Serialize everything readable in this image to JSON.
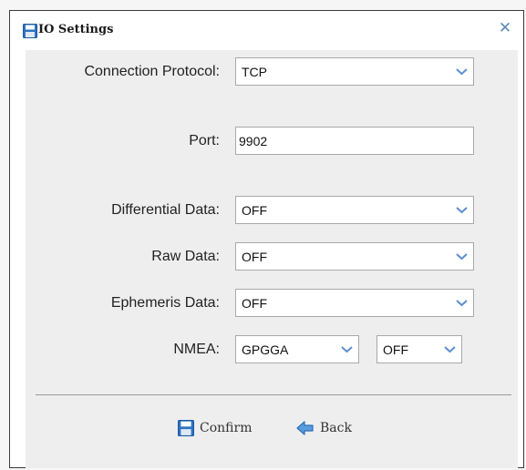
{
  "window": {
    "title": "IO Settings"
  },
  "form": {
    "connection_protocol": {
      "label": "Connection Protocol:",
      "value": "TCP"
    },
    "port": {
      "label": "Port:",
      "value": "9902"
    },
    "differential_data": {
      "label": "Differential Data:",
      "value": "OFF"
    },
    "raw_data": {
      "label": "Raw Data:",
      "value": "OFF"
    },
    "ephemeris_data": {
      "label": "Ephemeris Data:",
      "value": "OFF"
    },
    "nmea": {
      "label": "NMEA:",
      "type_value": "GPGGA",
      "rate_value": "OFF"
    }
  },
  "footer": {
    "confirm_label": "Confirm",
    "back_label": "Back"
  },
  "colors": {
    "accent": "#2c6fb6",
    "arrow": "#5b8fd0"
  }
}
